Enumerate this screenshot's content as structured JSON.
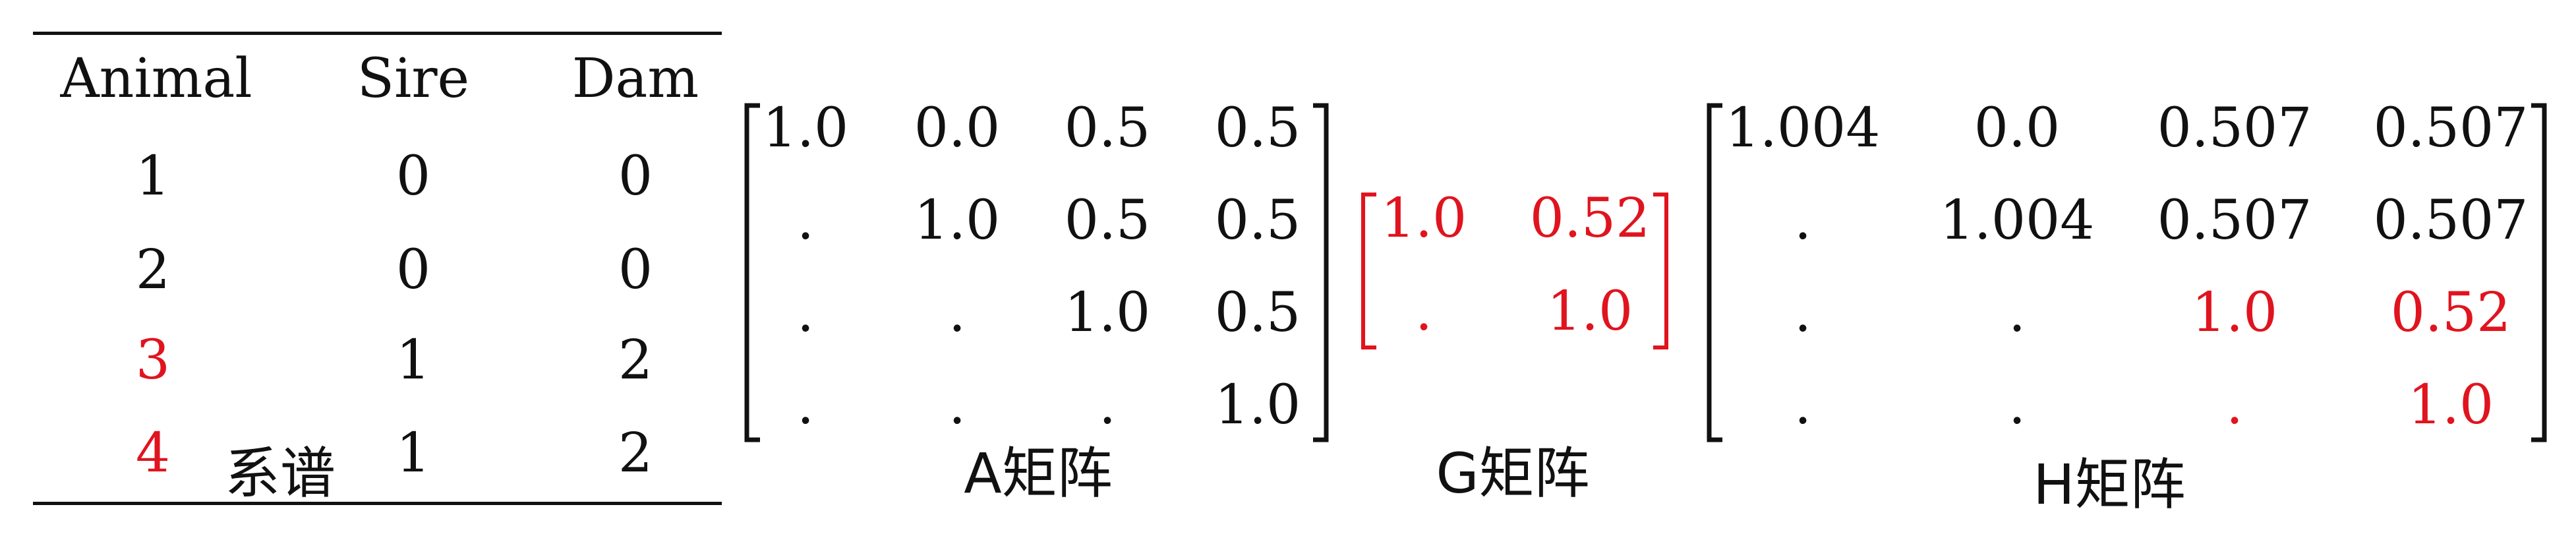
{
  "pedigree": {
    "header": [
      "Animal",
      "Sire",
      "Dam"
    ],
    "rows": [
      {
        "animal": "1",
        "sire": "0",
        "dam": "0",
        "highlight": false
      },
      {
        "animal": "2",
        "sire": "0",
        "dam": "0",
        "highlight": false
      },
      {
        "animal": "3",
        "sire": "1",
        "dam": "2",
        "highlight": true
      },
      {
        "animal": "4",
        "sire": "1",
        "dam": "2",
        "highlight": true
      }
    ],
    "caption": "系谱"
  },
  "a_matrix": {
    "caption": "A矩阵",
    "cells": [
      [
        "1.0",
        "0.0",
        "0.5",
        "0.5"
      ],
      [
        ".",
        "1.0",
        "0.5",
        "0.5"
      ],
      [
        ".",
        ".",
        "1.0",
        "0.5"
      ],
      [
        ".",
        ".",
        ".",
        "1.0"
      ]
    ]
  },
  "g_matrix": {
    "caption": "G矩阵",
    "cells": [
      [
        "1.0",
        "0.52"
      ],
      [
        ".",
        "1.0"
      ]
    ]
  },
  "h_matrix": {
    "caption": "H矩阵",
    "cells": [
      [
        "1.004",
        "0.0",
        "0.507",
        "0.507"
      ],
      [
        ".",
        "1.004",
        "0.507",
        "0.507"
      ],
      [
        ".",
        ".",
        "1.0",
        "0.52"
      ],
      [
        ".",
        ".",
        ".",
        "1.0"
      ]
    ]
  },
  "colors": {
    "text": "#111111",
    "highlight": "#e0141e"
  }
}
